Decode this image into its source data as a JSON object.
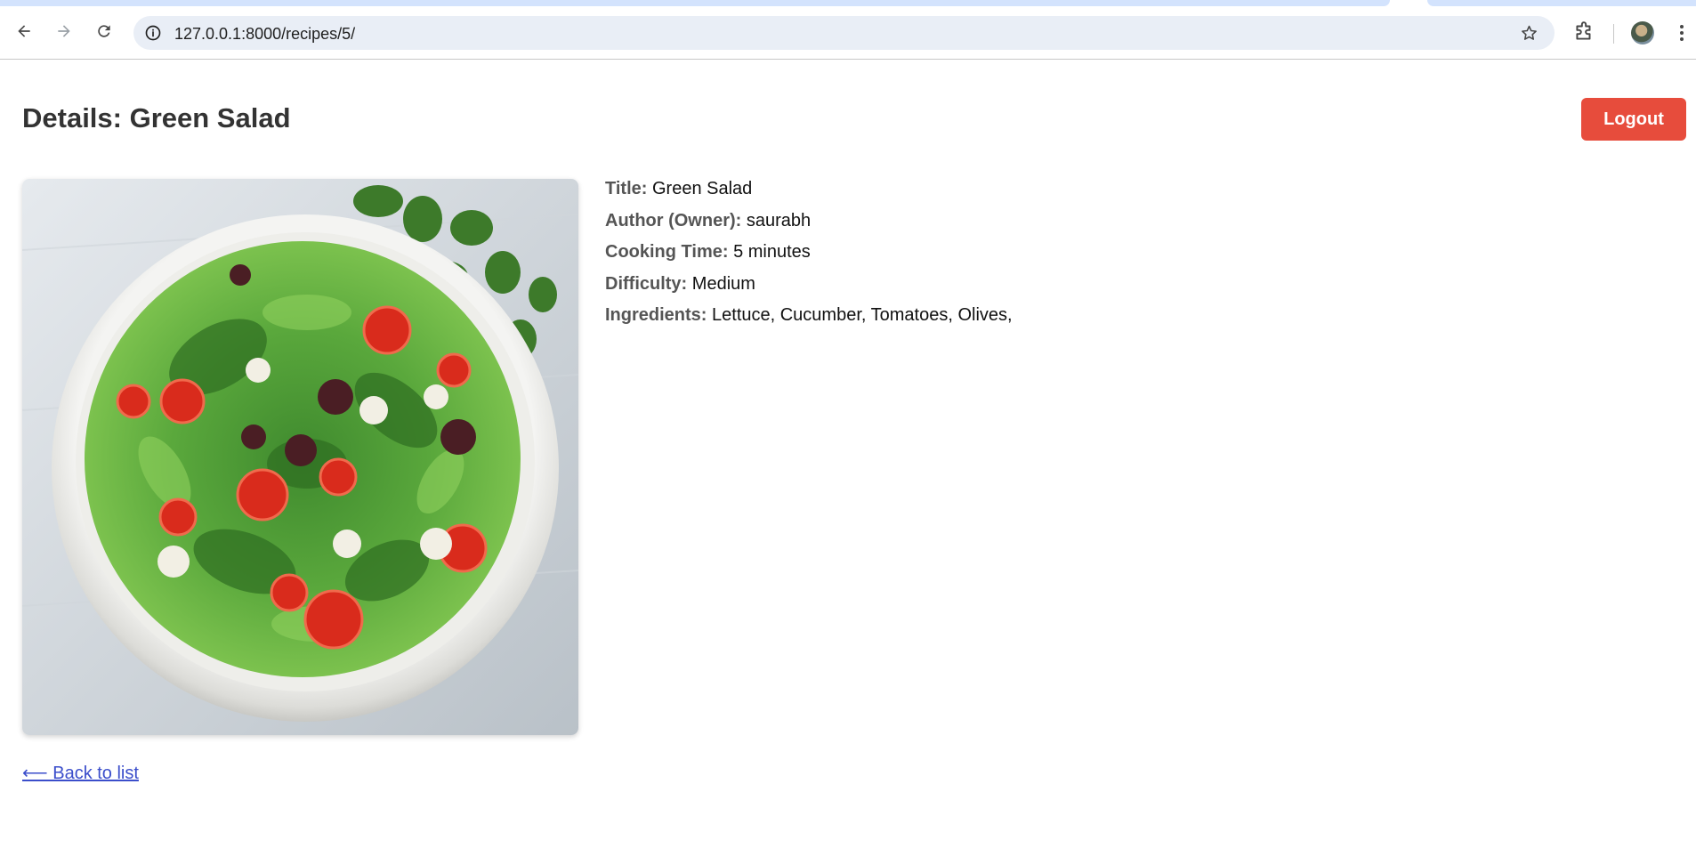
{
  "browser": {
    "url": "127.0.0.1:8000/recipes/5/"
  },
  "header": {
    "title": "Details: Green Salad",
    "logout_label": "Logout"
  },
  "image": {
    "subject": "salad-bowl-photo"
  },
  "details": [
    {
      "label": "Title:",
      "value": "Green Salad"
    },
    {
      "label": "Author (Owner):",
      "value": "saurabh"
    },
    {
      "label": "Cooking Time:",
      "value": "5 minutes"
    },
    {
      "label": "Difficulty:",
      "value": "Medium"
    },
    {
      "label": "Ingredients:",
      "value": "Lettuce, Cucumber, Tomatoes, Olives,"
    }
  ],
  "footer": {
    "back_label": "⟵ Back to list"
  },
  "colors": {
    "accent_logout": "#e74c3c",
    "link": "#3b4ecb"
  }
}
